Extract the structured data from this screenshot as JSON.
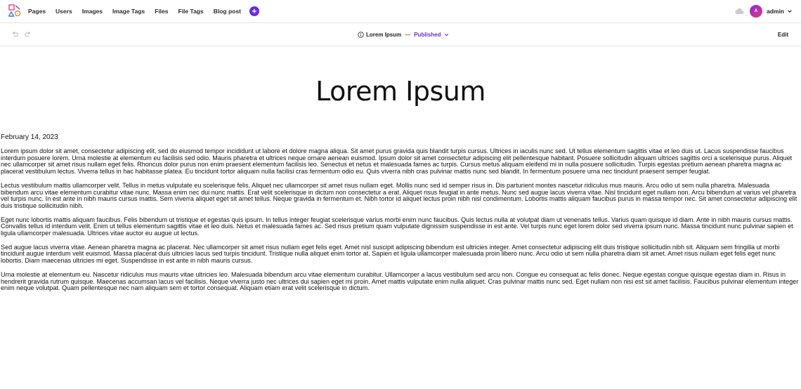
{
  "nav": {
    "items": [
      {
        "label": "Pages"
      },
      {
        "label": "Users"
      },
      {
        "label": "Images"
      },
      {
        "label": "Image Tags"
      },
      {
        "label": "Files"
      },
      {
        "label": "File Tags"
      },
      {
        "label": "Blog post"
      }
    ],
    "add_label": "+"
  },
  "user": {
    "avatar_letter": "A",
    "name": "admin"
  },
  "editor": {
    "doc_title": "Lorem Ipsum",
    "separator": "—",
    "status": "Published",
    "edit_label": "Edit"
  },
  "content": {
    "title": "Lorem Ipsum",
    "date": "February 14, 2023",
    "paragraphs": [
      "Lorem ipsum dolor sit amet, consectetur adipiscing elit, sed do eiusmod tempor incididunt ut labore et dolore magna aliqua. Sit amet purus gravida quis blandit turpis cursus. Ultrices in iaculis nunc sed. Ut tellus elementum sagittis vitae et leo duis ut. Lacus suspendisse faucibus interdum posuere lorem. Urna molestie at elementum eu facilisis sed odio. Mauris pharetra et ultrices neque ornare aenean euismod. Ipsum dolor sit amet consectetur adipiscing elit pellentesque habitant. Posuere sollicitudin aliquam ultrices sagittis orci a scelerisque purus. Aliquet nec ullamcorper sit amet risus nullam eget felis. Rhoncus dolor purus non enim praesent elementum facilisis leo. Senectus et netus et malesuada fames ac turpis. Cursus metus aliquam eleifend mi in nulla posuere sollicitudin. Turpis egestas pretium aenean pharetra magna ac placerat vestibulum lectus. Viverra tellus in hac habitasse platea. Eu tincidunt tortor aliquam nulla facilisi cras fermentum odio eu. Quis viverra nibh cras pulvinar mattis nunc sed blandit. In fermentum posuere urna nec tincidunt praesent semper feugiat.",
      "Lectus vestibulum mattis ullamcorper velit. Tellus in metus vulputate eu scelerisque felis. Aliquet nec ullamcorper sit amet risus nullam eget. Mollis nunc sed id semper risus in. Dis parturient montes nascetur ridiculus mus mauris. Arcu odio ut sem nulla pharetra. Malesuada bibendum arcu vitae elementum curabitur vitae nunc. Massa enim nec dui nunc mattis. Erat velit scelerisque in dictum non consectetur a erat. Aliquet risus feugiat in ante metus. Nunc sed augue lacus viverra vitae. Nisl tincidunt eget nullam non. Arcu bibendum at varius vel pharetra vel turpis nunc. In est ante in nibh mauris cursus mattis. Sem viverra aliquet eget sit amet tellus. Neque gravida in fermentum et. Nibh tortor id aliquet lectus proin nibh nisl condimentum. Lobortis mattis aliquam faucibus purus in massa tempor nec. Sit amet consectetur adipiscing elit duis tristique sollicitudin nibh.",
      "Eget nunc lobortis mattis aliquam faucibus. Felis bibendum ut tristique et egestas quis ipsum. In tellus integer feugiat scelerisque varius morbi enim nunc faucibus. Quis lectus nulla at volutpat diam ut venenatis tellus. Varius quam quisque id diam. Ante in nibh mauris cursus mattis. Convallis tellus id interdum velit. Enim ut tellus elementum sagittis vitae et leo duis. Netus et malesuada fames ac. Sed risus pretium quam vulputate dignissim suspendisse in est ante. Vel turpis nunc eget lorem dolor sed viverra ipsum nunc. Massa tincidunt nunc pulvinar sapien et ligula ullamcorper malesuada. Ultrices vitae auctor eu augue ut lectus.",
      "Sed augue lacus viverra vitae. Aenean pharetra magna ac placerat. Nec ullamcorper sit amet risus nullam eget felis eget. Amet nisl suscipit adipiscing bibendum est ultricies integer. Amet consectetur adipiscing elit duis tristique sollicitudin nibh sit. Aliquam sem fringilla ut morbi tincidunt augue interdum velit euismod. Massa placerat duis ultricies lacus sed turpis tincidunt. Tristique nulla aliquet enim tortor at. Sapien et ligula ullamcorper malesuada proin libero nunc. Arcu odio ut sem nulla pharetra diam sit amet. Amet risus nullam eget felis eget nunc lobortis. Diam maecenas ultricies mi eget. Suspendisse in est ante in nibh mauris cursus.",
      "Urna molestie at elementum eu. Nascetur ridiculus mus mauris vitae ultricies leo. Malesuada bibendum arcu vitae elementum curabitur. Ullamcorper a lacus vestibulum sed arcu non. Congue eu consequat ac felis donec. Neque egestas congue quisque egestas diam in. Risus in hendrerit gravida rutrum quisque. Maecenas accumsan lacus vel facilisis. Neque viverra justo nec ultrices dui sapien eget mi proin. Amet mattis vulputate enim nulla aliquet. Cras pulvinar mattis nunc sed. Eget nullam non nisi est sit amet facilisis. Faucibus pulvinar elementum integer enim neque volutpat. Quam pellentesque nec nam aliquam sem et tortor consequat. Aliquam etiam erat velit scelerisque in dictum."
    ]
  },
  "icons": {
    "logo": "shapes-logo-icon",
    "cloud": "cloud-icon",
    "undo": "undo-icon",
    "redo": "redo-icon",
    "info": "info-circle-icon",
    "chevron": "chevron-down-icon"
  },
  "colors": {
    "accent": "#6b2cd9",
    "avatar_start": "#8a2cd6",
    "avatar_end": "#e03a7a",
    "border": "#e6e6ea"
  }
}
